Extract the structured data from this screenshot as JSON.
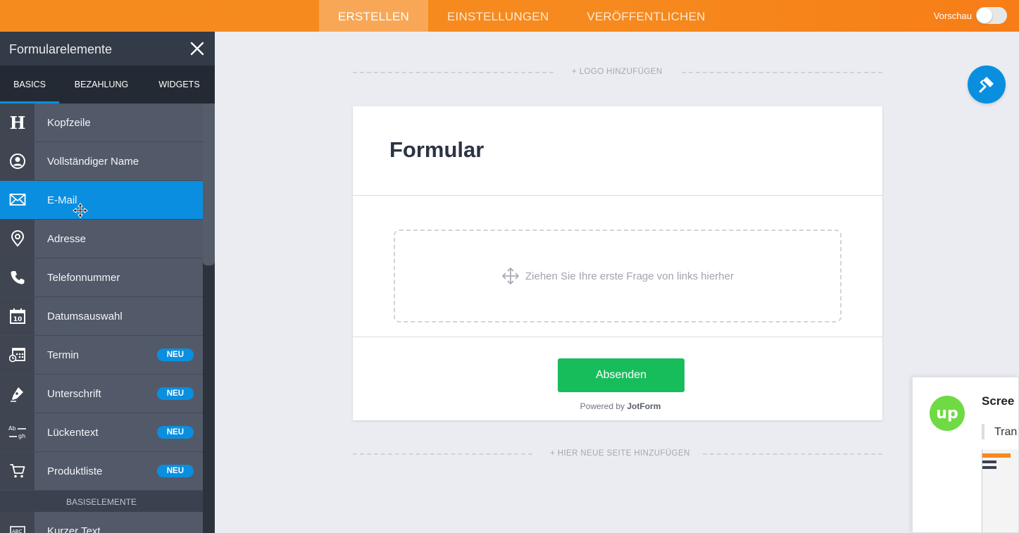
{
  "topbar": {
    "tabs": [
      {
        "label": "ERSTELLEN",
        "active": true
      },
      {
        "label": "EINSTELLUNGEN",
        "active": false
      },
      {
        "label": "VERÖFFENTLICHEN",
        "active": false
      }
    ],
    "preview_label": "Vorschau",
    "preview_enabled": false
  },
  "sidebar": {
    "title": "Formularelemente",
    "tabs": [
      "BASICS",
      "BEZAHLUNG",
      "WIDGETS"
    ],
    "active_tab": "BASICS",
    "items": [
      {
        "label": "Kopfzeile",
        "icon": "heading-icon"
      },
      {
        "label": "Vollständiger Name",
        "icon": "user-icon"
      },
      {
        "label": "E-Mail",
        "icon": "envelope-icon",
        "active": true
      },
      {
        "label": "Adresse",
        "icon": "location-pin-icon"
      },
      {
        "label": "Telefonnummer",
        "icon": "phone-icon"
      },
      {
        "label": "Datumsauswahl",
        "icon": "calendar-icon"
      },
      {
        "label": "Termin",
        "icon": "appointment-icon",
        "badge": "NEU"
      },
      {
        "label": "Unterschrift",
        "icon": "signature-pen-icon",
        "badge": "NEU"
      },
      {
        "label": "Lückentext",
        "icon": "fill-in-blank-icon",
        "badge": "NEU"
      },
      {
        "label": "Produktliste",
        "icon": "shopping-cart-icon",
        "badge": "NEU"
      }
    ],
    "section_label": "BASISELEMENTE",
    "next_item": {
      "label": "Kurzer Text",
      "icon": "short-text-icon"
    }
  },
  "canvas": {
    "add_logo": "+ LOGO HINZUFÜGEN",
    "form_title": "Formular",
    "drop_hint": "Ziehen Sie Ihre erste Frage von links hierher",
    "submit_label": "Absenden",
    "powered_prefix": "Powered by",
    "powered_brand": "JotForm",
    "add_page": "+ HIER NEUE SEITE HINZUFÜGEN"
  },
  "overlay": {
    "title": "Scree",
    "text": "Tran"
  },
  "colors": {
    "topbar": "#f68a1e",
    "accent": "#0a8fe0",
    "submit": "#18bd5b",
    "upwork": "#6fda44"
  }
}
